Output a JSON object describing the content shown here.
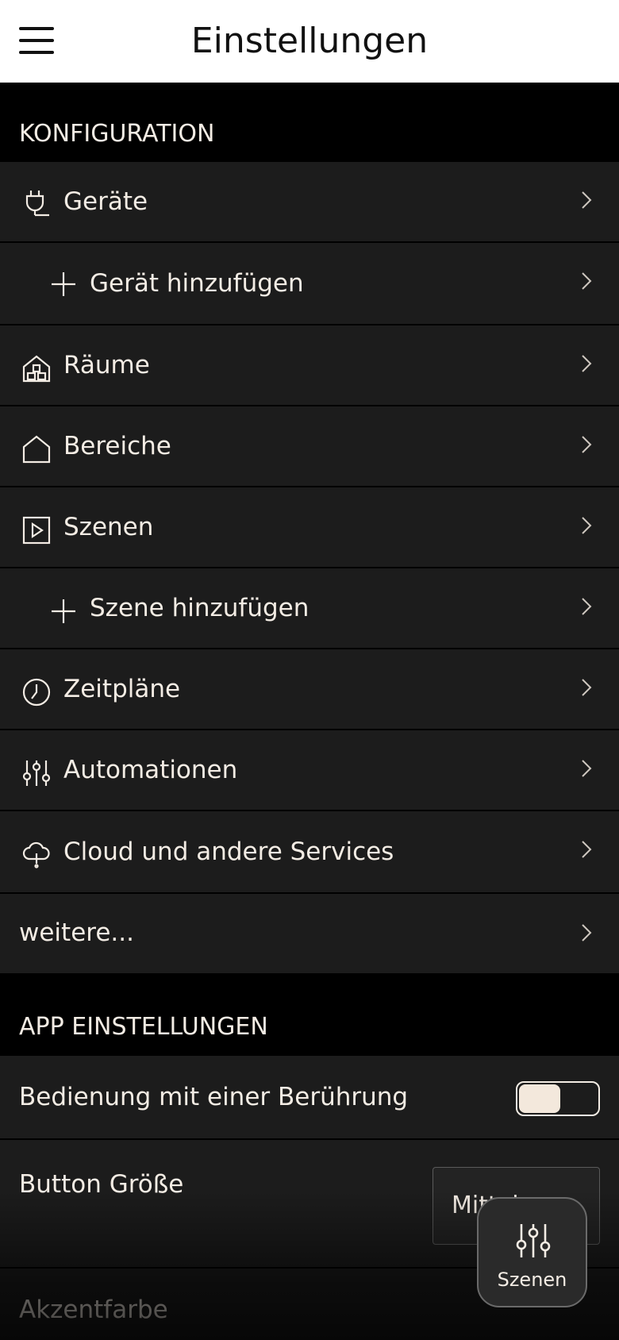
{
  "header": {
    "title": "Einstellungen"
  },
  "sections": {
    "configuration": "KONFIGURATION",
    "app_settings": "APP EINSTELLUNGEN"
  },
  "config_items": [
    {
      "label": "Geräte",
      "icon": "plug-icon"
    },
    {
      "label": "Gerät hinzufügen",
      "icon": "plus-icon"
    },
    {
      "label": "Räume",
      "icon": "house-rooms-icon"
    },
    {
      "label": "Bereiche",
      "icon": "house-icon"
    },
    {
      "label": "Szenen",
      "icon": "play-box-icon"
    },
    {
      "label": "Szene hinzufügen",
      "icon": "plus-icon"
    },
    {
      "label": "Zeitpläne",
      "icon": "clock-icon"
    },
    {
      "label": "Automationen",
      "icon": "sliders-icon"
    },
    {
      "label": "Cloud und andere Services",
      "icon": "cloud-icon"
    },
    {
      "label": "weitere...",
      "icon": ""
    }
  ],
  "app_items": {
    "one_touch": {
      "label": "Bedienung mit einer Berührung",
      "toggle_on": true
    },
    "button_size": {
      "label": "Button Größe",
      "value": "Mittel"
    },
    "accent_color": {
      "label": "Akzentfarbe"
    }
  },
  "fab": {
    "label": "Szenen",
    "icon": "sliders-icon"
  },
  "colors": {
    "accent": "#f3e8dc",
    "row_bg": "#1c1c1c",
    "text": "#f3ece4"
  }
}
